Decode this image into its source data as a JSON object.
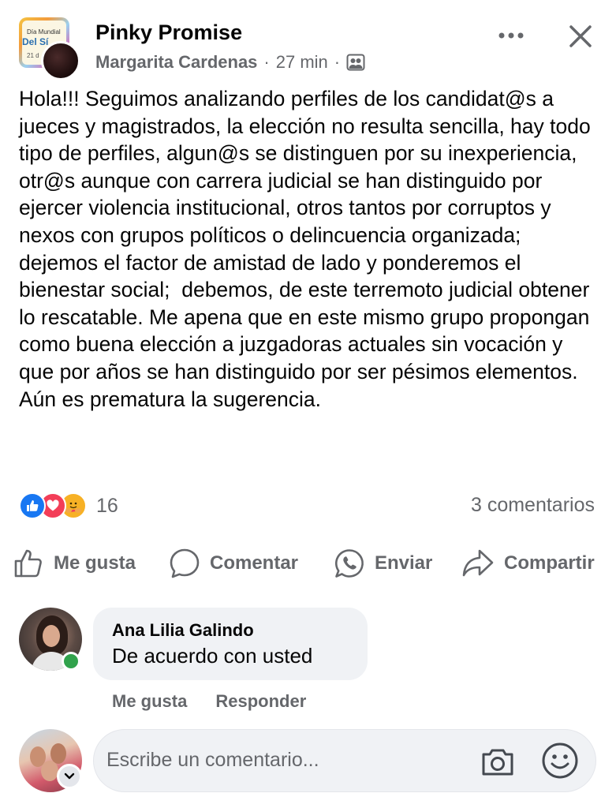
{
  "post": {
    "group_name": "Pinky Promise",
    "author": "Margarita Cardenas",
    "time": "27 min",
    "separator": "·",
    "group_thumbnail": {
      "line1": "Día Mundial",
      "line2": "Del Sí",
      "line3": "21 d"
    },
    "text": "Hola!!! Seguimos analizando perfiles de los candidat@s a jueces y magistrados, la elección no resulta sencilla, hay todo tipo de perfiles, algun@s se distinguen por su inexperiencia, otr@s aunque con carrera judicial se han distinguido por ejercer violencia institucional, otros tantos por corruptos y nexos con grupos políticos o delincuencia organizada; dejemos el factor de amistad de lado y ponderemos el bienestar social;  debemos, de este terremoto judicial obtener lo rescatable. Me apena que en este mismo grupo propongan como buena elección a juzgadoras actuales sin vocación y que por años se han distinguido por ser pésimos elementos. Aún es prematura la sugerencia.",
    "reaction_count": "16",
    "comment_count": "3 comentarios",
    "reaction_types": [
      "like",
      "love",
      "care"
    ]
  },
  "actions": {
    "like": "Me gusta",
    "comment": "Comentar",
    "send": "Enviar",
    "share": "Compartir"
  },
  "comment": {
    "author": "Ana Lilia Galindo",
    "text": "De acuerdo con usted",
    "like": "Me gusta",
    "reply": "Responder"
  },
  "composer": {
    "placeholder": "Escribe un comentario..."
  },
  "colors": {
    "text_primary": "#050505",
    "text_secondary": "#65676b",
    "bubble": "#f0f2f5",
    "like_blue": "#1877f2",
    "love_red": "#f33e58",
    "care_yellow": "#f7b125",
    "online_green": "#31a24c"
  }
}
